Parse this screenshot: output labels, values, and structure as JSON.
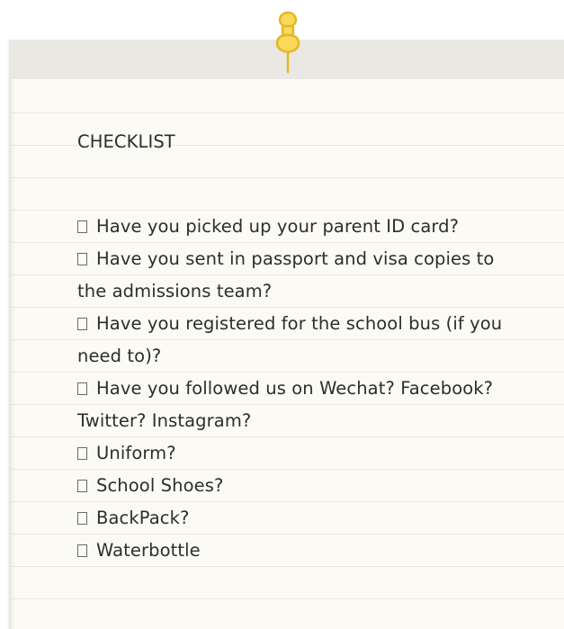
{
  "checklist": {
    "title": "CHECKLIST",
    "items": [
      "Have you picked up your parent ID card?",
      "Have you sent in passport and visa copies to the admissions team?",
      "Have you registered for the school bus (if you need to)?",
      "Have you followed us on Wechat? Facebook? Twitter? Instagram?",
      "Uniform?",
      "School Shoes?",
      "BackPack?",
      "Waterbottle"
    ]
  },
  "colors": {
    "paper": "#fbfaf4",
    "paper_band": "#e9e8e3",
    "ruled_line": "#ece9dc",
    "pin_fill": "#f9d85a",
    "pin_outline": "#e2b823",
    "text": "#2d2d2d"
  },
  "icons": {
    "pin": "pushpin-icon",
    "checkbox": "empty-checkbox-icon"
  }
}
